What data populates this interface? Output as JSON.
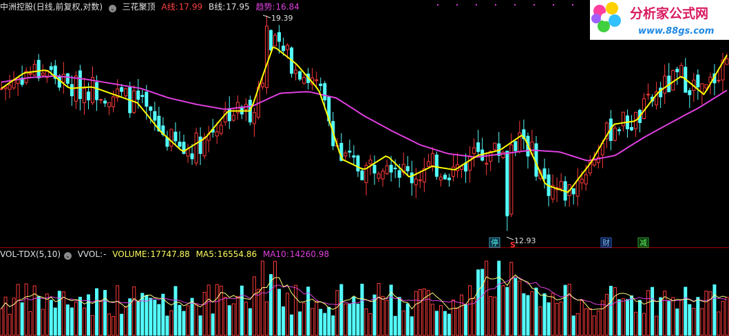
{
  "main": {
    "stock_name": "中洲控股",
    "period_label": "(日线,前复权,对数)",
    "indicator_name": "三花聚顶",
    "a_label": "A线:",
    "a_value": "17.99",
    "b_label": "B线:",
    "b_value": "17.95",
    "trend_label": "趋势:",
    "trend_value": "16.84",
    "high_marker": "19.39",
    "low_marker": "12.93",
    "tags": [
      "停",
      "S",
      "财",
      "减"
    ]
  },
  "volume": {
    "indicator": "VOL-TDX(5,10)",
    "vvol_label": "VVOL:",
    "vvol_value": "-",
    "volume_label": "VOLUME:",
    "volume_value": "17747.88",
    "ma5_label": "MA5:",
    "ma5_value": "16554.86",
    "ma10_label": "MA10:",
    "ma10_value": "14260.98"
  },
  "logo": {
    "text": "分析家公式网",
    "url_text": "www.88gs.com"
  },
  "colors": {
    "up": "#ff3b3b",
    "down": "#54ffff",
    "a_line": "#ffff00",
    "trend_line": "#e040e0",
    "ma5": "#ffffff",
    "ma10": "#ffff00"
  },
  "chart_data": [
    {
      "type": "candlestick",
      "title": "三花聚顶",
      "scale": "log",
      "y_range": [
        12.6,
        19.6
      ],
      "annotations": [
        {
          "label": "19.39",
          "type": "high"
        },
        {
          "label": "12.93",
          "type": "low"
        }
      ],
      "series": [
        {
          "name": "A线",
          "last": 17.99
        },
        {
          "name": "B线",
          "last": 17.95
        },
        {
          "name": "趋势",
          "last": 16.84
        }
      ],
      "trend_path_price": [
        17.1,
        17.25,
        17.3,
        17.2,
        17.05,
        16.9,
        16.6,
        16.4,
        16.25,
        16.35,
        16.75,
        16.8,
        16.6,
        16.05,
        15.6,
        15.2,
        14.95,
        14.85,
        14.95,
        15.05,
        15.0,
        14.75,
        14.9,
        15.4,
        15.85,
        16.3,
        16.84
      ],
      "a_line_price": [
        16.9,
        17.4,
        17.5,
        16.9,
        16.95,
        16.7,
        16.45,
        15.6,
        15.0,
        15.4,
        16.2,
        16.2,
        18.3,
        17.7,
        16.85,
        14.8,
        14.5,
        14.9,
        14.3,
        14.6,
        14.5,
        14.9,
        15.05,
        15.5,
        14.1,
        13.9,
        14.7,
        15.8,
        15.9,
        16.8,
        17.3,
        16.7,
        17.99
      ]
    },
    {
      "type": "bar",
      "title": "VOL-TDX(5,10)",
      "series": [
        {
          "name": "VOLUME",
          "last": 17747.88
        },
        {
          "name": "MA5",
          "last": 16554.86
        },
        {
          "name": "MA10",
          "last": 14260.98
        }
      ]
    }
  ]
}
